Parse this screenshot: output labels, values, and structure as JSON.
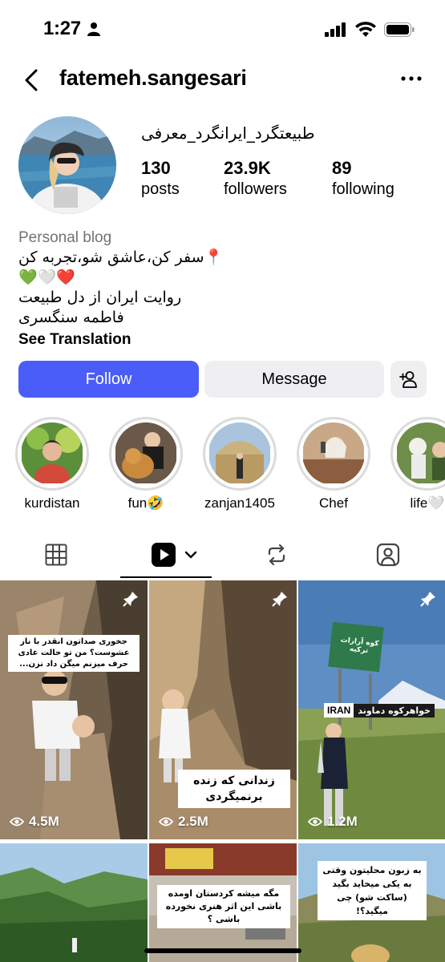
{
  "status": {
    "time": "1:27"
  },
  "header": {
    "username": "fatemeh.sangesari"
  },
  "profile": {
    "display_name": "طبیعتگرد_ایرانگرد_معرفی",
    "stats": {
      "posts_value": "130",
      "posts_label": "posts",
      "followers_value": "23.9K",
      "followers_label": "followers",
      "following_value": "89",
      "following_label": "following"
    },
    "bio": {
      "category": "Personal blog",
      "line1": "📍سفر کن،عاشق شو،تجربه کن",
      "line2": "💚🤍❤️",
      "line3": "روایت ایران از دل طبیعت",
      "line4": "فاطمه سنگسری",
      "see_translation": "See Translation"
    }
  },
  "actions": {
    "follow_label": "Follow",
    "message_label": "Message"
  },
  "highlights": [
    {
      "label": "kurdistan"
    },
    {
      "label": "fun🤣"
    },
    {
      "label": "zanjan1405"
    },
    {
      "label": "Chef"
    },
    {
      "label": "life🤍"
    }
  ],
  "tabs": [
    "grid-icon",
    "reels-icon",
    "reposts-icon",
    "tagged-icon"
  ],
  "posts": [
    {
      "views": "4.5M",
      "pinned": true,
      "overlay": "جخوری صداتون انقدر با ناز عشوست؟ من تو حالت عادی حرف میزنم میگن داد نزن..."
    },
    {
      "views": "2.5M",
      "pinned": true,
      "overlay": "زندانی که زنده برنمیگردی"
    },
    {
      "views": "1.2M",
      "pinned": true,
      "overlay": "خواهرکوه دماوند",
      "overlay_tag": "IRAN",
      "sign_text": "کوه آرارات ترکیه"
    },
    {
      "views": "",
      "pinned": false,
      "overlay": ""
    },
    {
      "views": "",
      "pinned": false,
      "overlay": "مگه میشه کردستان اومده باشی این اثر هنری نخورده باشی ؟"
    },
    {
      "views": "",
      "pinned": false,
      "overlay": "به زبون محلیتون وقتی به یکی میخاید بگید (ساکت شو) چی میگید؟!"
    }
  ],
  "colors": {
    "follow_bg": "#4a5df9",
    "button_bg": "#efeff2",
    "category_text": "#737373"
  }
}
